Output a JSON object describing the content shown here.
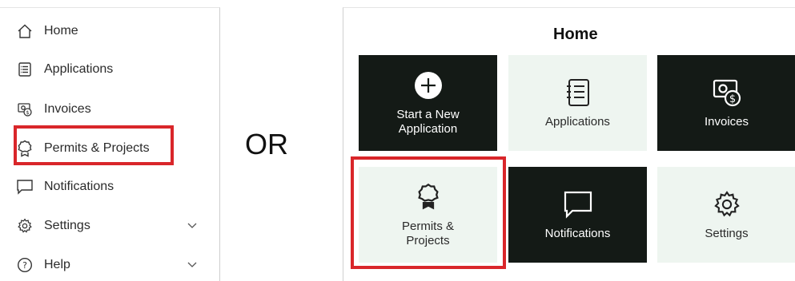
{
  "sidebar": {
    "items": [
      {
        "label": "Home",
        "icon": "home-icon"
      },
      {
        "label": "Applications",
        "icon": "applications-icon"
      },
      {
        "label": "Invoices",
        "icon": "invoices-icon"
      },
      {
        "label": "Permits & Projects",
        "icon": "permit-badge-icon"
      },
      {
        "label": "Notifications",
        "icon": "notifications-icon"
      },
      {
        "label": "Settings",
        "icon": "gear-icon"
      },
      {
        "label": "Help",
        "icon": "help-icon"
      }
    ]
  },
  "divider_text": "OR",
  "home_panel": {
    "title": "Home",
    "tiles": [
      {
        "label_line1": "Start a New",
        "label_line2": "Application",
        "icon": "plus-circle-icon"
      },
      {
        "label_line1": "Applications",
        "label_line2": "",
        "icon": "applications-icon"
      },
      {
        "label_line1": "Invoices",
        "label_line2": "",
        "icon": "invoices-icon"
      },
      {
        "label_line1": "Permits &",
        "label_line2": "Projects",
        "icon": "permit-badge-icon"
      },
      {
        "label_line1": "Notifications",
        "label_line2": "",
        "icon": "notifications-icon"
      },
      {
        "label_line1": "Settings",
        "label_line2": "",
        "icon": "gear-icon"
      }
    ]
  },
  "colors": {
    "highlight": "#d9262a",
    "dark_tile": "#141a16",
    "light_tile": "#eef5f0"
  }
}
